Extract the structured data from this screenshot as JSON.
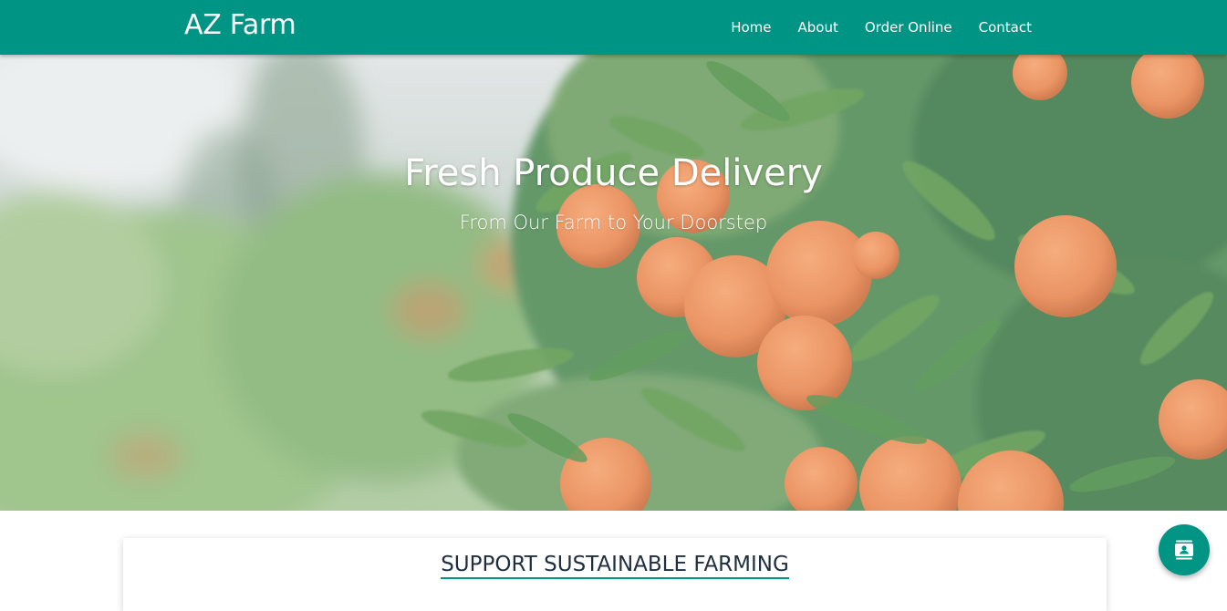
{
  "brand": "AZ Farm",
  "nav": {
    "items": [
      "Home",
      "About",
      "Order Online",
      "Contact"
    ]
  },
  "hero": {
    "title": "Fresh Produce Delivery",
    "subtitle": "From Our Farm to Your Doorstep"
  },
  "section": {
    "title": "SUPPORT SUSTAINABLE FARMING"
  },
  "fab": {
    "icon": "contact-card-icon"
  },
  "colors": {
    "primary": "#009485",
    "nav_text": "#ffffff",
    "heading_text": "#1f2f3f"
  }
}
